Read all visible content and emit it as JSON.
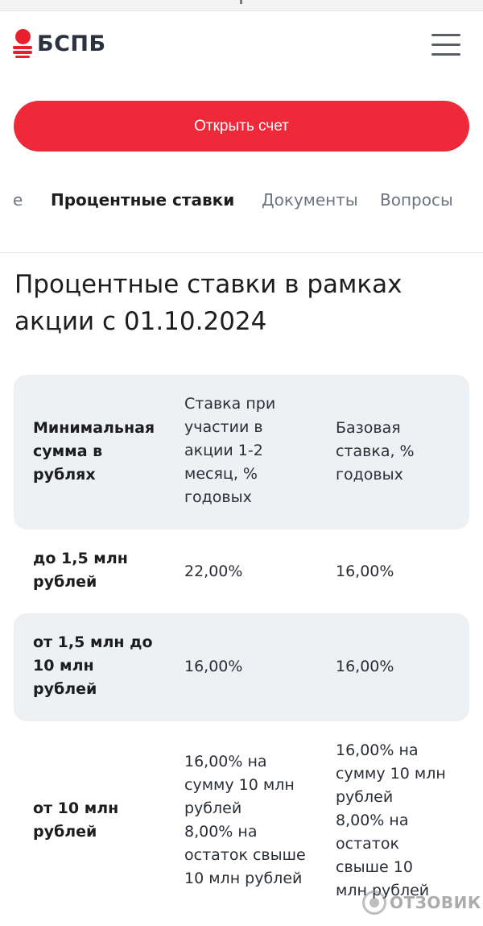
{
  "header": {
    "logo_text": "БСПБ",
    "menu_icon": "hamburger-menu-icon"
  },
  "cta": {
    "open_account_label": "Открыть счет"
  },
  "tabs": [
    {
      "label": "е",
      "active": false
    },
    {
      "label": "Процентные ставки",
      "active": true
    },
    {
      "label": "Документы",
      "active": false
    },
    {
      "label": "Вопросы",
      "active": false
    }
  ],
  "section": {
    "title_line1": "Процентные ставки в рамках",
    "title_line2": "акции с 01.10.2024"
  },
  "rates_table": {
    "headers": [
      "Минимальная\nсумма в\nрублях",
      "Ставка при\nучастии в\nакции 1-2\nмесяц, %\nгодовых",
      "Базовая\nставка, %\nгодовых"
    ],
    "rows": [
      [
        "до 1,5 млн\nрублей",
        "22,00%",
        "16,00%"
      ],
      [
        "от 1,5 млн до\n10 млн\nрублей",
        "16,00%",
        "16,00%"
      ],
      [
        "от 10 млн\nрублей",
        "16,00% на\nсумму 10 млн\nрублей\n8,00% на\nостаток свыше\n10 млн рублей",
        "16,00% на\nсумму 10 млн\nрублей\n8,00% на\nостаток\nсвыше 10\nмлн рублей"
      ]
    ]
  },
  "watermark": {
    "text": "ОТЗОВИК"
  },
  "colors": {
    "brand_red": "#ee2a3a",
    "row_shade": "#eef1f4"
  }
}
